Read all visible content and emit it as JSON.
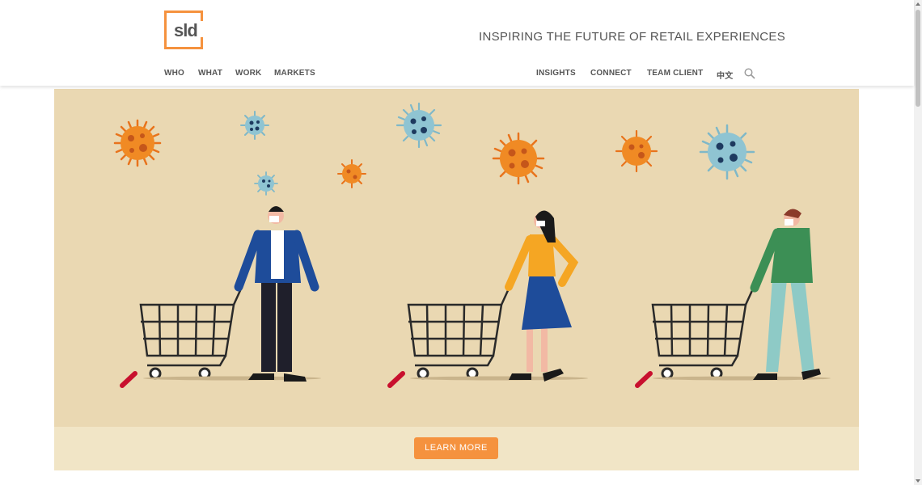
{
  "logo": {
    "text": "sld"
  },
  "tagline": "INSPIRING THE FUTURE OF RETAIL EXPERIENCES",
  "nav_left": [
    "WHO",
    "WHAT",
    "WORK",
    "MARKETS"
  ],
  "nav_right": [
    "INSIGHTS",
    "CONNECT",
    "TEAM CLIENT",
    "中文"
  ],
  "hero": {
    "button": "LEARN MORE"
  },
  "colors": {
    "accent": "#f5923e",
    "hero_bg": "#ead8b2",
    "text": "#555555"
  },
  "icons": [
    "search-icon",
    "virus-icon",
    "shopping-cart-icon"
  ]
}
